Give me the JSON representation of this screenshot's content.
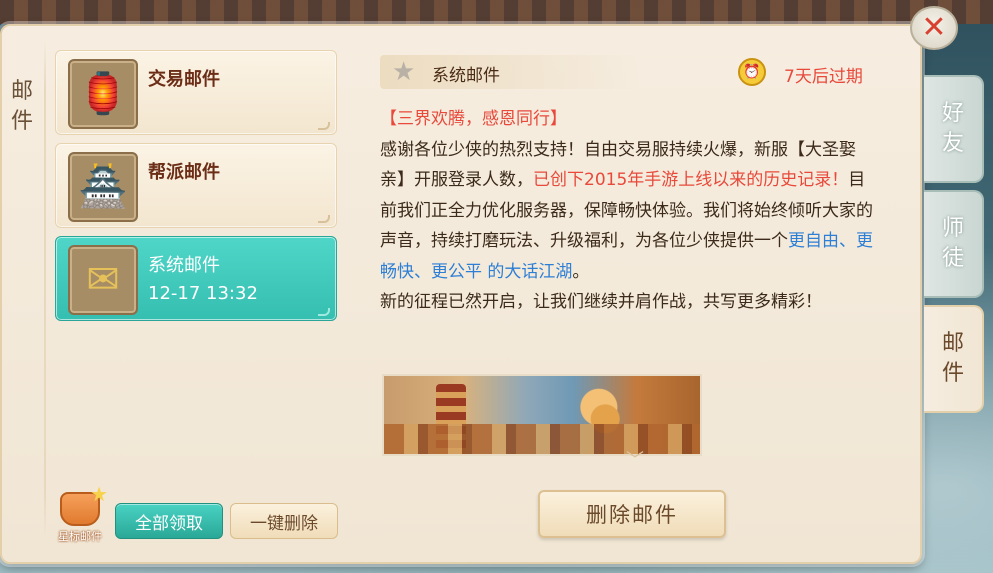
{
  "left_tab": {
    "chars": [
      "邮",
      "件"
    ]
  },
  "mail_list": [
    {
      "title": "交易邮件",
      "date": "",
      "icon": "trade-shop-icon",
      "active": false
    },
    {
      "title": "帮派邮件",
      "date": "",
      "icon": "guild-building-icon",
      "active": false
    },
    {
      "title": "系统邮件",
      "date": "12-17 13:32",
      "icon": "envelope-icon",
      "active": true
    }
  ],
  "bottom_left": {
    "star_mail_label": "星标邮件",
    "claim_all": "全部领取",
    "delete_all": "一键删除"
  },
  "mail_detail": {
    "header_title": "系统邮件",
    "expire_text": "7天后过期",
    "lines": {
      "title": "【三界欢腾，感恩同行】",
      "p1_a": "感谢各位少侠的热烈支持！自由交易服持续火爆，新服【大圣娶亲】开服登录人数，",
      "p1_red": "已创下2015年手游上线以来的历史记录！",
      "p1_b": "目前我们正全力优化服务器，保障畅快体验。我们将始终倾听大家的声音，持续打磨玩法、升级福利，为各位少侠提供一个",
      "p1_blue": "更自由、更畅快、更公平 的大话江湖",
      "p1_c": "。",
      "p2": "新的征程已然开启，让我们继续并肩作战，共写更多精彩！"
    },
    "delete_button": "删除邮件"
  },
  "right_tabs": [
    {
      "label_top": "好",
      "label_bottom": "友",
      "active": false
    },
    {
      "label_top": "师",
      "label_bottom": "徒",
      "active": false
    },
    {
      "label_top": "邮",
      "label_bottom": "件",
      "active": true
    }
  ],
  "colors": {
    "accent_teal": "#35bfb0",
    "expire_red": "#e8493b",
    "link_blue": "#2d7fd6",
    "panel_cream": "#f6ede0"
  }
}
